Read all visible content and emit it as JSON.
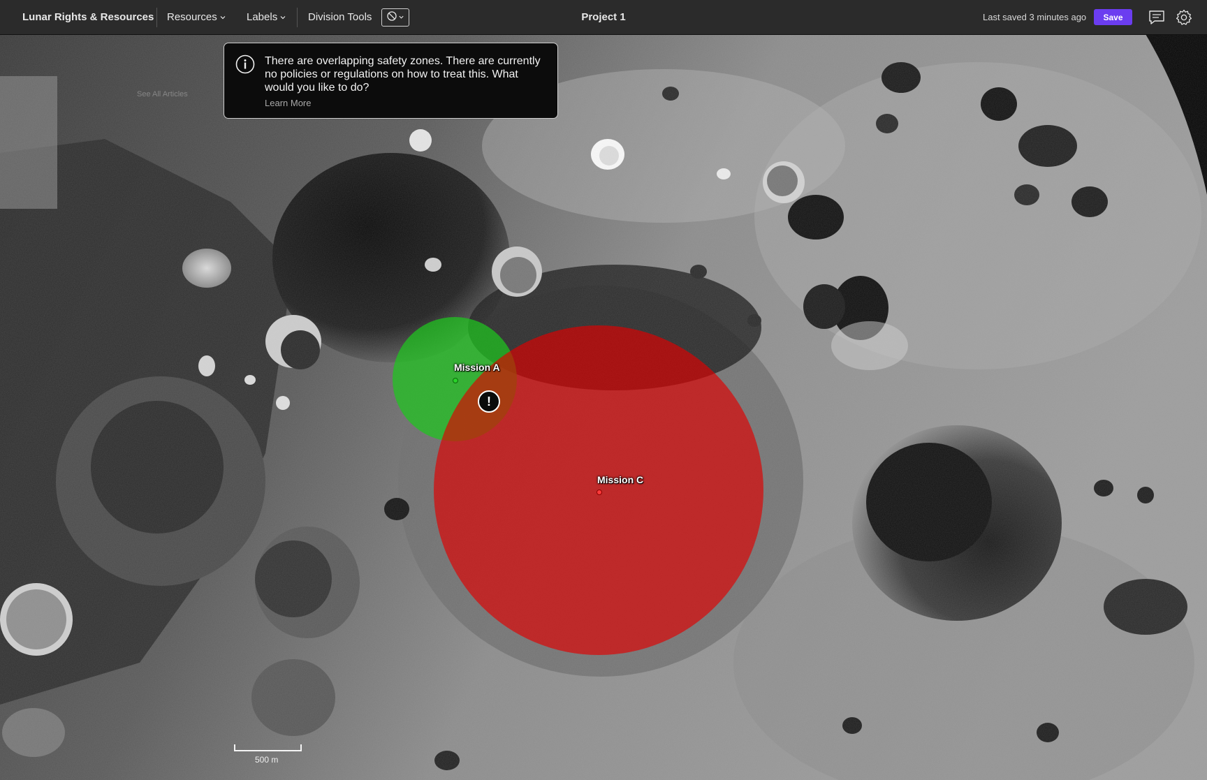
{
  "header": {
    "brand": "Lunar Rights & Resources",
    "menus": [
      {
        "label": "Resources"
      },
      {
        "label": "Labels"
      },
      {
        "label": "Division Tools"
      }
    ],
    "project_title": "Project 1",
    "last_saved": "Last saved 3 minutes ago",
    "save_label": "Save",
    "icons": [
      "no-entry-icon",
      "comment-icon",
      "gear-icon"
    ]
  },
  "map": {
    "see_all_link": "See All Articles",
    "alert": {
      "message": "There are overlapping safety zones. There are currently no policies or regulations on how to treat this. What would you like to do?",
      "link": "Learn More",
      "icon": "info-icon"
    },
    "zones": [
      {
        "name": "Mission A",
        "color": "#22cc22"
      },
      {
        "name": "Mission C",
        "color": "#dd1111"
      }
    ],
    "overlap_badge": "!",
    "scale_label": "500 m"
  },
  "colors": {
    "accent": "#6b3df0",
    "topbar": "#2b2b2b"
  }
}
